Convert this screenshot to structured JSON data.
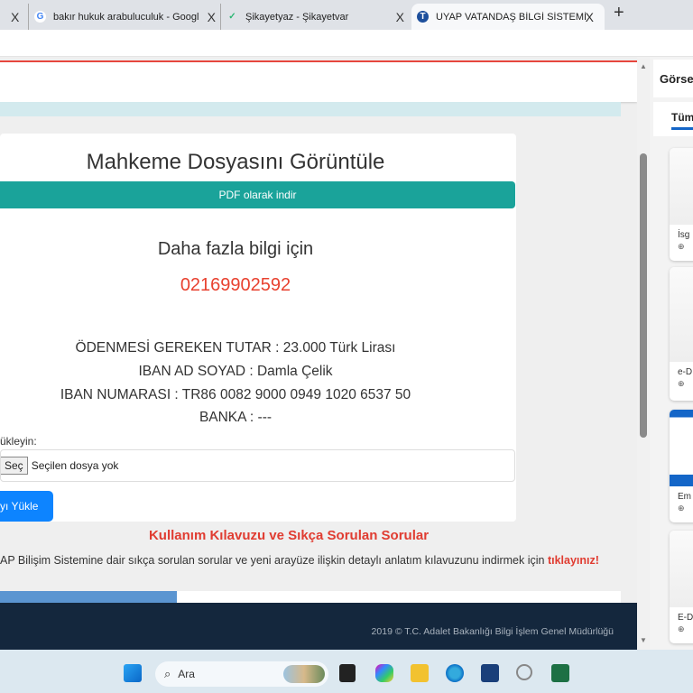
{
  "browser": {
    "tabs": [
      {
        "title": "",
        "icon": "partial-tab"
      },
      {
        "title": "bakır hukuk arabuluculuk - Googl",
        "icon": "google-icon"
      },
      {
        "title": "Şikayetyaz - Şikayetvar",
        "icon": "sikayetvar-icon"
      },
      {
        "title": "UYAP VATANDAŞ BİLGİ SİSTEMİ",
        "icon": "uyap-icon",
        "active": true
      }
    ],
    "close_glyph": "X",
    "new_tab_glyph": "+"
  },
  "main": {
    "title": "Mahkeme Dosyasını Görüntüle",
    "pdf_button": "PDF olarak indir",
    "more_info": "Daha fazla bilgi için",
    "phone": "02169902592",
    "lines": [
      "ÖDENMESİ GEREKEN TUTAR : 23.000 Türk Lirası",
      "IBAN AD SOYAD : Damla Çelik",
      "IBAN NUMARASI : TR86 0082 9000 0949 1020 6537 50",
      "BANKA : ---"
    ],
    "upload_label": "ükleyin:",
    "choose_button": "Seç",
    "no_file": "Seçilen dosya yok",
    "upload_button": "yı Yükle",
    "guide_title": "Kullanım Kılavuzu ve Sıkça Sorulan Sorular",
    "guide_text": "AP Bilişim Sistemine dair sıkça sorulan sorular ve yeni arayüze ilişkin detaylı anlatım kılavuzunu indirmek için ",
    "guide_link": "tıklayınız!",
    "footer": "2019 © T.C. Adalet Bakanlığı Bilgi İşlem Genel Müdürlüğü"
  },
  "sidebar": {
    "title": "Görse",
    "tab": "Tüm",
    "cards": [
      {
        "label": "İsg"
      },
      {
        "label": "e-D"
      },
      {
        "label": "Em"
      },
      {
        "label": "E-D"
      }
    ]
  },
  "taskbar": {
    "search_placeholder": "Ara"
  },
  "colors": {
    "accent_teal": "#1aa39a",
    "phone_red": "#e8412f",
    "upload_blue": "#0d84ff",
    "footer": "#14273d"
  }
}
